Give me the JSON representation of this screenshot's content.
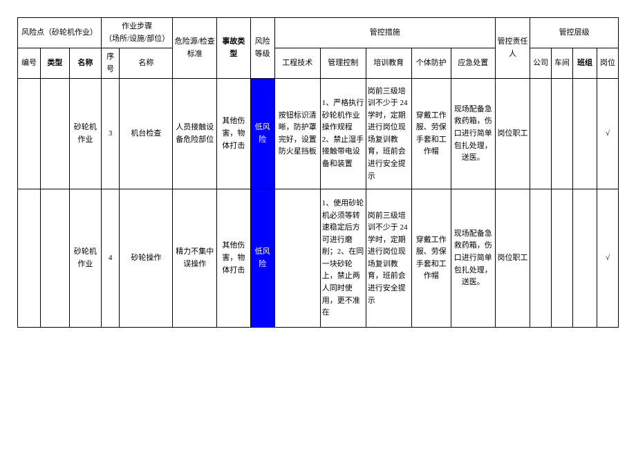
{
  "header": {
    "risk_point": "风险点（砂轮机作业）",
    "work_step": "作业步骤\n（场所/设施/部位）",
    "hazard_source": "危险源/检查标准",
    "accident_type": "事故类型",
    "risk_level": "风险等级",
    "control_measures": "管控措施",
    "responsible": "管控责任人",
    "control_level": "管控层级",
    "no": "编号",
    "type": "类型",
    "name": "名称",
    "seq": "序号",
    "step_name": "名称",
    "eng_tech": "工程技术",
    "mgmt_ctrl": "管理控制",
    "training": "培训教育",
    "ppe": "个体防护",
    "emergency": "应急处置",
    "company": "公司",
    "workshop": "车间",
    "team": "班组",
    "post": "岗位"
  },
  "rows": [
    {
      "name": "砂轮机作业",
      "seq": "3",
      "step_name": "机台检查",
      "hazard": "人员接触设备危险部位",
      "accident": "其他伤害，物体打击",
      "risk": "低风险",
      "eng": "按钮标识清晰，防护罩完好，设置防火星挡板",
      "mgmt": "1、严格执行砂轮机作业操作规程 2、禁止湿手接触带电设备和装置",
      "train": "岗前三级培训不少于 24 学时，定期进行岗位现场复训教育，班前会进行安全提示",
      "ppe": "穿戴工作服、劳保手套和工作帽",
      "emerg": "现场配备急救药箱，伤口进行简单包扎处理，送医。",
      "resp": "岗位职工",
      "post_chk": "√"
    },
    {
      "name": "砂轮机作业",
      "seq": "4",
      "step_name": "砂轮操作",
      "hazard": "精力不集中误操作",
      "accident": "其他伤害，物体打击",
      "risk": "低风险",
      "eng": "",
      "mgmt": "1、使用砂轮机必须等转速稳定后方可进行磨削；2、在同一块砂轮上，禁止两人同时使用，更不准在",
      "train": "岗前三级培训不少于 24 学时，定期进行岗位现场复训教育，班前会进行安全提示",
      "ppe": "穿戴工作服、劳保手套和工作帽",
      "emerg": "现场配备急救药箱，伤口进行简单包扎处理，送医。",
      "resp": "岗位职工",
      "post_chk": "√"
    }
  ]
}
